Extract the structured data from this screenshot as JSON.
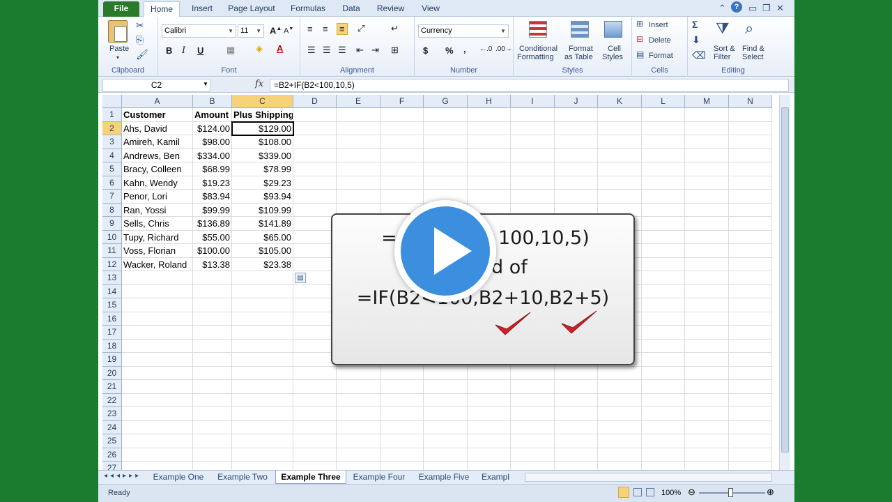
{
  "ribbon": {
    "tabs": [
      "File",
      "Home",
      "Insert",
      "Page Layout",
      "Formulas",
      "Data",
      "Review",
      "View"
    ],
    "groups": {
      "clipboard": "Clipboard",
      "font": "Font",
      "alignment": "Alignment",
      "number": "Number",
      "styles": "Styles",
      "cells": "Cells",
      "editing": "Editing"
    },
    "paste": "Paste",
    "font_name": "Calibri",
    "font_size": "11",
    "number_format": "Currency",
    "conditional_formatting": [
      "Conditional",
      "Formatting"
    ],
    "format_as_table": [
      "Format",
      "as Table"
    ],
    "cell_styles": [
      "Cell",
      "Styles"
    ],
    "insert": "Insert",
    "delete": "Delete",
    "format": "Format",
    "sort_filter": [
      "Sort &",
      "Filter"
    ],
    "find_select": [
      "Find &",
      "Select"
    ],
    "bold": "B",
    "italic": "I",
    "underline": "U",
    "dollar": "$",
    "percent": "%",
    "comma": ","
  },
  "formula_bar": {
    "name_box": "C2",
    "fx": "fx",
    "formula": "=B2+IF(B2<100,10,5)"
  },
  "grid": {
    "columns": [
      "A",
      "B",
      "C",
      "D",
      "E",
      "F",
      "G",
      "H",
      "I",
      "J",
      "K",
      "L",
      "M",
      "N"
    ],
    "rows": [
      "1",
      "2",
      "3",
      "4",
      "5",
      "6",
      "7",
      "8",
      "9",
      "10",
      "11",
      "12",
      "13",
      "14",
      "15",
      "16",
      "17",
      "18",
      "19",
      "20",
      "21",
      "22",
      "23",
      "24",
      "25",
      "26",
      "27"
    ],
    "headers": [
      "Customer",
      "Amount",
      "Plus Shipping"
    ],
    "data": [
      [
        "Ahs, David",
        "$124.00",
        "$129.00"
      ],
      [
        "Amireh, Kamil",
        "$98.00",
        "$108.00"
      ],
      [
        "Andrews, Ben",
        "$334.00",
        "$339.00"
      ],
      [
        "Bracy, Colleen",
        "$68.99",
        "$78.99"
      ],
      [
        "Kahn, Wendy",
        "$19.23",
        "$29.23"
      ],
      [
        "Penor, Lori",
        "$83.94",
        "$93.94"
      ],
      [
        "Ran, Yossi",
        "$99.99",
        "$109.99"
      ],
      [
        "Sells, Chris",
        "$136.89",
        "$141.89"
      ],
      [
        "Tupy, Richard",
        "$55.00",
        "$65.00"
      ],
      [
        "Voss, Florian",
        "$100.00",
        "$105.00"
      ],
      [
        "Wacker, Roland",
        "$13.38",
        "$23.38"
      ]
    ],
    "active_cell": "C2"
  },
  "sheets": [
    "Example One",
    "Example Two",
    "Example Three",
    "Example Four",
    "Example Five",
    "Exampl"
  ],
  "active_sheet": "Example Three",
  "status": {
    "ready": "Ready",
    "zoom": "100%"
  },
  "overlay": {
    "line1_left": "=",
    "line1_right": "100,10,5)",
    "line2": "d of",
    "line3": "=IF(B2<100,B2+10,B2+5)"
  },
  "colors": {
    "background": "#1a7c2e",
    "file_tab": "#2a7a2a",
    "selected_header": "#f8d27a",
    "play_button": "#3b8fde",
    "checkmark": "#d0202a"
  },
  "icons": [
    "paste-icon",
    "cut-icon",
    "copy-icon",
    "format-painter-icon",
    "play-icon",
    "checkmark-icon",
    "help-icon",
    "minimize-icon",
    "restore-icon",
    "close-icon"
  ]
}
